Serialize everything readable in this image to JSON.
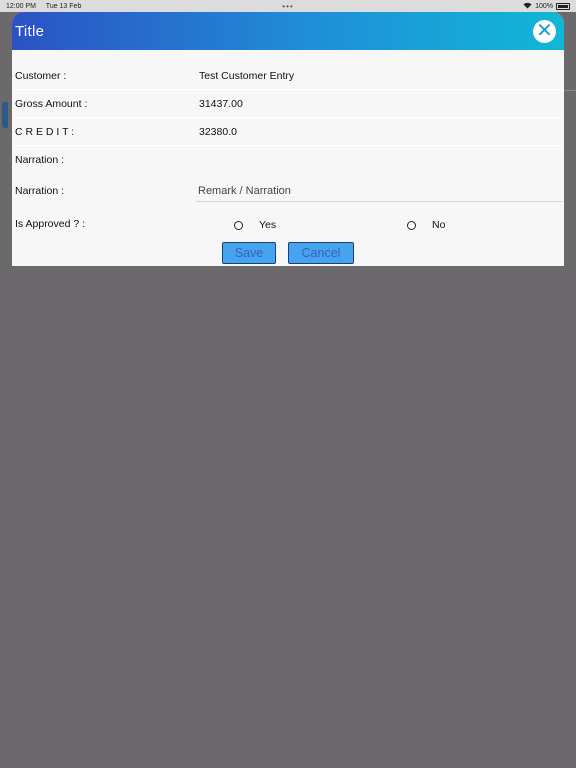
{
  "status_bar": {
    "time": "12:00 PM",
    "date": "Tue 13 Feb",
    "center_dots": "•••",
    "battery": "100%"
  },
  "dialog": {
    "title": "Title",
    "close_icon": "close-icon",
    "fields": [
      {
        "label": "Customer :",
        "value": "Test Customer Entry"
      },
      {
        "label": "Gross Amount :",
        "value": "31437.00"
      },
      {
        "label": "C R E D I T :",
        "value": "32380.0"
      },
      {
        "label": "Narration :",
        "value": ""
      }
    ],
    "narration_input": {
      "label": "Narration :",
      "placeholder": "Remark / Narration",
      "value": ""
    },
    "approval": {
      "label": "Is Approved ?  :",
      "options": [
        "Yes",
        "No"
      ],
      "selected": null
    },
    "buttons": {
      "save": "Save",
      "cancel": "Cancel"
    }
  },
  "colors": {
    "header_gradient_start": "#2c52c4",
    "header_gradient_end": "#11b7d6",
    "button_bg": "#45a3f0",
    "button_text": "#3a61b8",
    "overlay": "#6c696c"
  }
}
